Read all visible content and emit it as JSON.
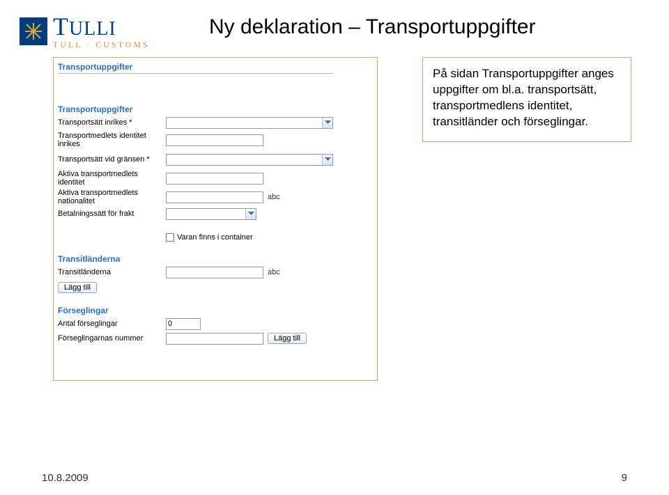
{
  "logo": {
    "main": "TULLI",
    "sub": "TULL · CUSTOMS"
  },
  "title": "Ny deklaration – Transportuppgifter",
  "panel": {
    "section_transport_header": "Transportuppgifter",
    "section_transport_sub": "Transportuppgifter",
    "transport_inrikes": "Transportsätt inrikes *",
    "transportmedlets_identitet": "Transportmedlets identitet inrikes",
    "transport_gransen": "Transportsätt vid gränsen *",
    "aktiva_identitet": "Aktiva transportmedlets identitet",
    "aktiva_nationalitet": "Aktiva transportmedlets nationalitet",
    "betalningssatt": "Betalningssätt för frakt",
    "abc": "abc",
    "container_checkbox": "Varan finns i container",
    "section_transit": "Transitländerna",
    "transit_label": "Transitländerna",
    "lagg_till": "Lägg till",
    "section_forseglingar": "Förseglingar",
    "antal_label": "Antal förseglingar",
    "antal_value": "0",
    "nummer_label": "Förseglingarnas nummer"
  },
  "info": "På sidan Transportuppgifter anges uppgifter om bl.a. transportsätt, transportmedlens identitet, transitländer och förseglingar.",
  "footer": {
    "date": "10.8.2009",
    "page": "9"
  }
}
